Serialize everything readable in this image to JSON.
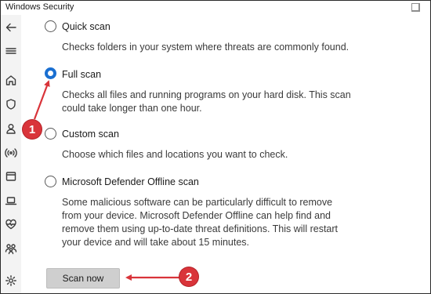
{
  "window": {
    "title": "Windows Security"
  },
  "sidebar": {
    "icons": [
      "back-arrow-icon",
      "hamburger-menu-icon",
      "home-icon",
      "shield-icon",
      "person-icon",
      "wireless-icon",
      "app-browser-icon",
      "laptop-icon",
      "heart-health-icon",
      "family-icon",
      "gear-icon"
    ]
  },
  "scan_options": [
    {
      "label": "Quick scan",
      "description": "Checks folders in your system where threats are commonly found.",
      "selected": false
    },
    {
      "label": "Full scan",
      "description": "Checks all files and running programs on your hard disk. This scan could take longer than one hour.",
      "selected": true
    },
    {
      "label": "Custom scan",
      "description": "Choose which files and locations you want to check.",
      "selected": false
    },
    {
      "label": "Microsoft Defender Offline scan",
      "description": "Some malicious software can be particularly difficult to remove from your device. Microsoft Defender Offline can help find and remove them using up-to-date threat definitions. This will restart your device and will take about 15 minutes.",
      "selected": false
    }
  ],
  "scan_button": {
    "label": "Scan now"
  },
  "annotations": {
    "step1": "1",
    "step2": "2",
    "color": "#d9343a"
  },
  "colors": {
    "accent": "#1a6fd1",
    "button_bg": "#cfcfcf"
  }
}
